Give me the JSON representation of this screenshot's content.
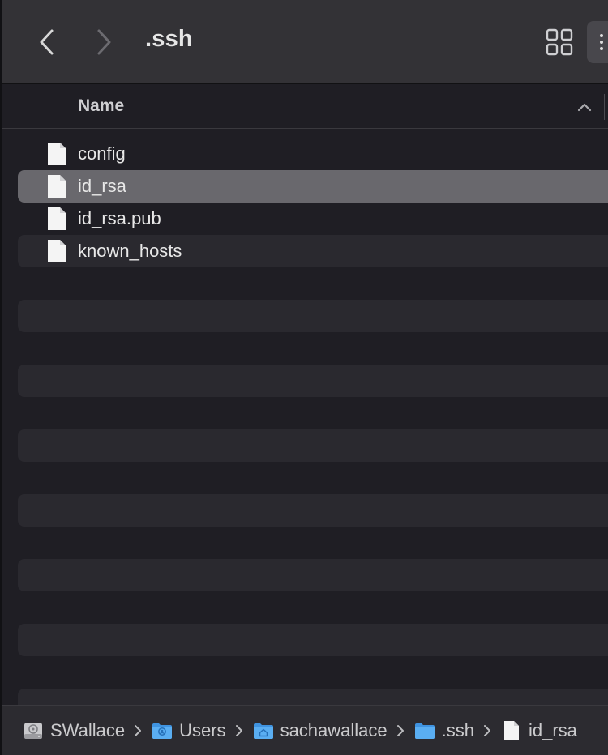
{
  "toolbar": {
    "title": ".ssh",
    "back_icon": "chevron-left-icon",
    "forward_icon": "chevron-right-icon",
    "view_icon": "grid-view-icon",
    "more_icon": "more-options-icon"
  },
  "column_header": {
    "name_label": "Name",
    "sort_direction": "ascending"
  },
  "files": [
    {
      "name": "config",
      "selected": false
    },
    {
      "name": "id_rsa",
      "selected": true
    },
    {
      "name": "id_rsa.pub",
      "selected": false
    },
    {
      "name": "known_hosts",
      "selected": false
    }
  ],
  "pathbar": {
    "crumbs": [
      {
        "label": "SWallace",
        "icon": "hard-drive-icon"
      },
      {
        "label": "Users",
        "icon": "users-folder-icon"
      },
      {
        "label": "sachawallace",
        "icon": "home-folder-icon"
      },
      {
        "label": ".ssh",
        "icon": "folder-icon"
      },
      {
        "label": "id_rsa",
        "icon": "file-icon"
      }
    ]
  },
  "colors": {
    "toolbar_bg": "#333236",
    "list_bg": "#1f1e24",
    "stripe": "#2a292f",
    "selection": "#69686d",
    "folder_blue": "#4aa3f0"
  }
}
